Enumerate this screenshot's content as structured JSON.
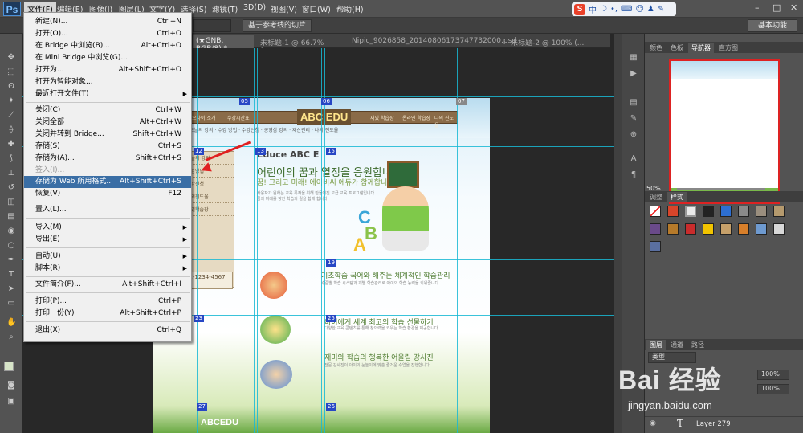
{
  "app": {
    "logo": "Ps"
  },
  "menubar": {
    "items": [
      "文件(F)",
      "编辑(E)",
      "图像(I)",
      "图层(L)",
      "文字(Y)",
      "选择(S)",
      "滤镜(T)",
      "3D(D)",
      "视图(V)",
      "窗口(W)",
      "帮助(H)"
    ]
  },
  "ime": {
    "logo": "S",
    "mode": "中"
  },
  "options_bar": {
    "slice_button": "基于参考线的切片",
    "workspace": "基本功能"
  },
  "doc_tabs": [
    "(★GNB, RGB/8) *",
    "未标题-1 @ 66.7% (...",
    "Nipic_9026858_20140806173747732000.psd",
    "未标题-2 @ 100% (..."
  ],
  "file_menu": {
    "items": [
      {
        "label": "新建(N)...",
        "shortcut": "Ctrl+N"
      },
      {
        "label": "打开(O)...",
        "shortcut": "Ctrl+O"
      },
      {
        "label": "在 Bridge 中浏览(B)...",
        "shortcut": "Alt+Ctrl+O"
      },
      {
        "label": "在 Mini Bridge 中浏览(G)...",
        "shortcut": ""
      },
      {
        "label": "打开为...",
        "shortcut": "Alt+Shift+Ctrl+O"
      },
      {
        "label": "打开为智能对象...",
        "shortcut": ""
      },
      {
        "label": "最近打开文件(T)",
        "shortcut": "",
        "submenu": true
      },
      {
        "label": "关闭(C)",
        "shortcut": "Ctrl+W"
      },
      {
        "label": "关闭全部",
        "shortcut": "Alt+Ctrl+W"
      },
      {
        "label": "关闭并转到 Bridge...",
        "shortcut": "Shift+Ctrl+W"
      },
      {
        "label": "存储(S)",
        "shortcut": "Ctrl+S"
      },
      {
        "label": "存储为(A)...",
        "shortcut": "Shift+Ctrl+S"
      },
      {
        "label": "签入(I)...",
        "shortcut": "",
        "disabled": true
      },
      {
        "label": "存储为 Web 所用格式...",
        "shortcut": "Alt+Shift+Ctrl+S",
        "highlighted": true
      },
      {
        "label": "恢复(V)",
        "shortcut": "F12"
      },
      {
        "label": "置入(L)...",
        "shortcut": ""
      },
      {
        "label": "导入(M)",
        "shortcut": "",
        "submenu": true
      },
      {
        "label": "导出(E)",
        "shortcut": "",
        "submenu": true
      },
      {
        "label": "自动(U)",
        "shortcut": "",
        "submenu": true
      },
      {
        "label": "脚本(R)",
        "shortcut": "",
        "submenu": true
      },
      {
        "label": "文件简介(F)...",
        "shortcut": "Alt+Shift+Ctrl+I"
      },
      {
        "label": "打印(P)...",
        "shortcut": "Ctrl+P"
      },
      {
        "label": "打印一份(Y)",
        "shortcut": "Alt+Shift+Ctrl+P"
      },
      {
        "label": "退出(X)",
        "shortcut": "Ctrl+Q"
      }
    ]
  },
  "canvas": {
    "slices": [
      "05",
      "06",
      "07",
      "12",
      "13",
      "15",
      "19",
      "23",
      "25",
      "27",
      "26"
    ],
    "site_logo": "ABC EDU",
    "site_logo2": "ABCEDU",
    "phone": "02-1234-4567"
  },
  "panels": {
    "top_tabs": [
      "颜色",
      "色板",
      "导航器",
      "直方图"
    ],
    "zoom": "50%",
    "mid_tabs": [
      "调整",
      "样式"
    ],
    "layer_tabs": [
      "图层",
      "通道",
      "路径"
    ],
    "layer_kind": "类型",
    "opacity": "100%",
    "fill": "100%",
    "layer_name": "Layer 279"
  },
  "watermark": {
    "text": "Bai 经验",
    "url": "jingyan.baidu.com"
  },
  "colors": {
    "menu_highlight": "#3a6ea5",
    "guide": "#19b8d4",
    "slice": "#2747c5"
  }
}
